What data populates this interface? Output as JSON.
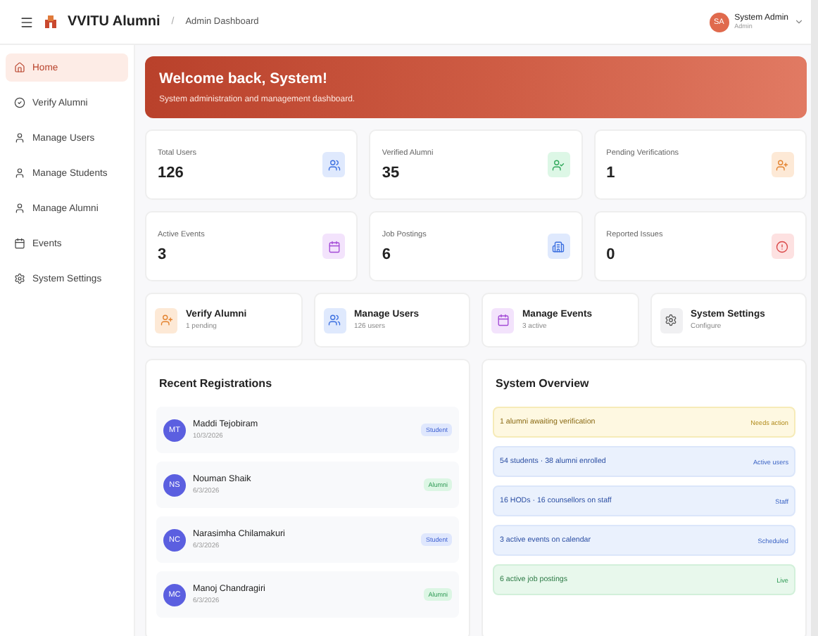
{
  "header": {
    "brand": "VVITU Alumni",
    "separator": "/",
    "page": "Admin Dashboard",
    "user": {
      "initials": "SA",
      "name": "System Admin",
      "role": "Admin"
    }
  },
  "sidebar": {
    "items": [
      {
        "label": "Home",
        "kind": "home",
        "selected": true
      },
      {
        "label": "Verify Alumni",
        "kind": "verify",
        "selected": false
      },
      {
        "label": "Manage Users",
        "kind": "users",
        "selected": false
      },
      {
        "label": "Manage Students",
        "kind": "students",
        "selected": false
      },
      {
        "label": "Manage Alumni",
        "kind": "alumni",
        "selected": false
      },
      {
        "label": "Events",
        "kind": "events",
        "selected": false
      },
      {
        "label": "System Settings",
        "kind": "settings",
        "selected": false
      }
    ]
  },
  "banner": {
    "title": "Welcome back, System!",
    "subtitle": "System administration and management dashboard."
  },
  "stats": [
    {
      "label": "Total Users",
      "value": "126",
      "kind": "users"
    },
    {
      "label": "Verified Alumni",
      "value": "35",
      "kind": "verified"
    },
    {
      "label": "Pending Verifications",
      "value": "1",
      "kind": "pending"
    },
    {
      "label": "Active Events",
      "value": "3",
      "kind": "events"
    },
    {
      "label": "Job Postings",
      "value": "6",
      "kind": "jobs"
    },
    {
      "label": "Reported Issues",
      "value": "0",
      "kind": "issues"
    }
  ],
  "quick_actions": [
    {
      "title": "Verify Alumni",
      "detail": "1 pending",
      "kind": "pending"
    },
    {
      "title": "Manage Users",
      "detail": "126 users",
      "kind": "users"
    },
    {
      "title": "Manage Events",
      "detail": "3 active",
      "kind": "events"
    },
    {
      "title": "System Settings",
      "detail": "Configure",
      "kind": "settings"
    }
  ],
  "recent_registrations": {
    "title": "Recent Registrations",
    "rows": [
      {
        "initials": "MT",
        "name": "Maddi Tejobiram",
        "date": "10/3/2026",
        "role": "Student",
        "kind": "student"
      },
      {
        "initials": "NS",
        "name": "Nouman Shaik",
        "date": "6/3/2026",
        "role": "Alumni",
        "kind": "alumni"
      },
      {
        "initials": "NC",
        "name": "Narasimha Chilamakuri",
        "date": "6/3/2026",
        "role": "Student",
        "kind": "student"
      },
      {
        "initials": "MC",
        "name": "Manoj Chandragiri",
        "date": "6/3/2026",
        "role": "Alumni",
        "kind": "alumni"
      }
    ]
  },
  "system_overview": {
    "title": "System Overview",
    "items": [
      {
        "text": "1 alumni awaiting verification",
        "status": "Needs action",
        "kind": "warning"
      },
      {
        "text": "54 students · 38 alumni enrolled",
        "status": "Active users",
        "kind": "info"
      },
      {
        "text": "16 HODs · 16 counsellors on staff",
        "status": "Staff",
        "kind": "info"
      },
      {
        "text": "3 active events on calendar",
        "status": "Scheduled",
        "kind": "info"
      },
      {
        "text": "6 active job postings",
        "status": "Live",
        "kind": "success"
      }
    ]
  }
}
